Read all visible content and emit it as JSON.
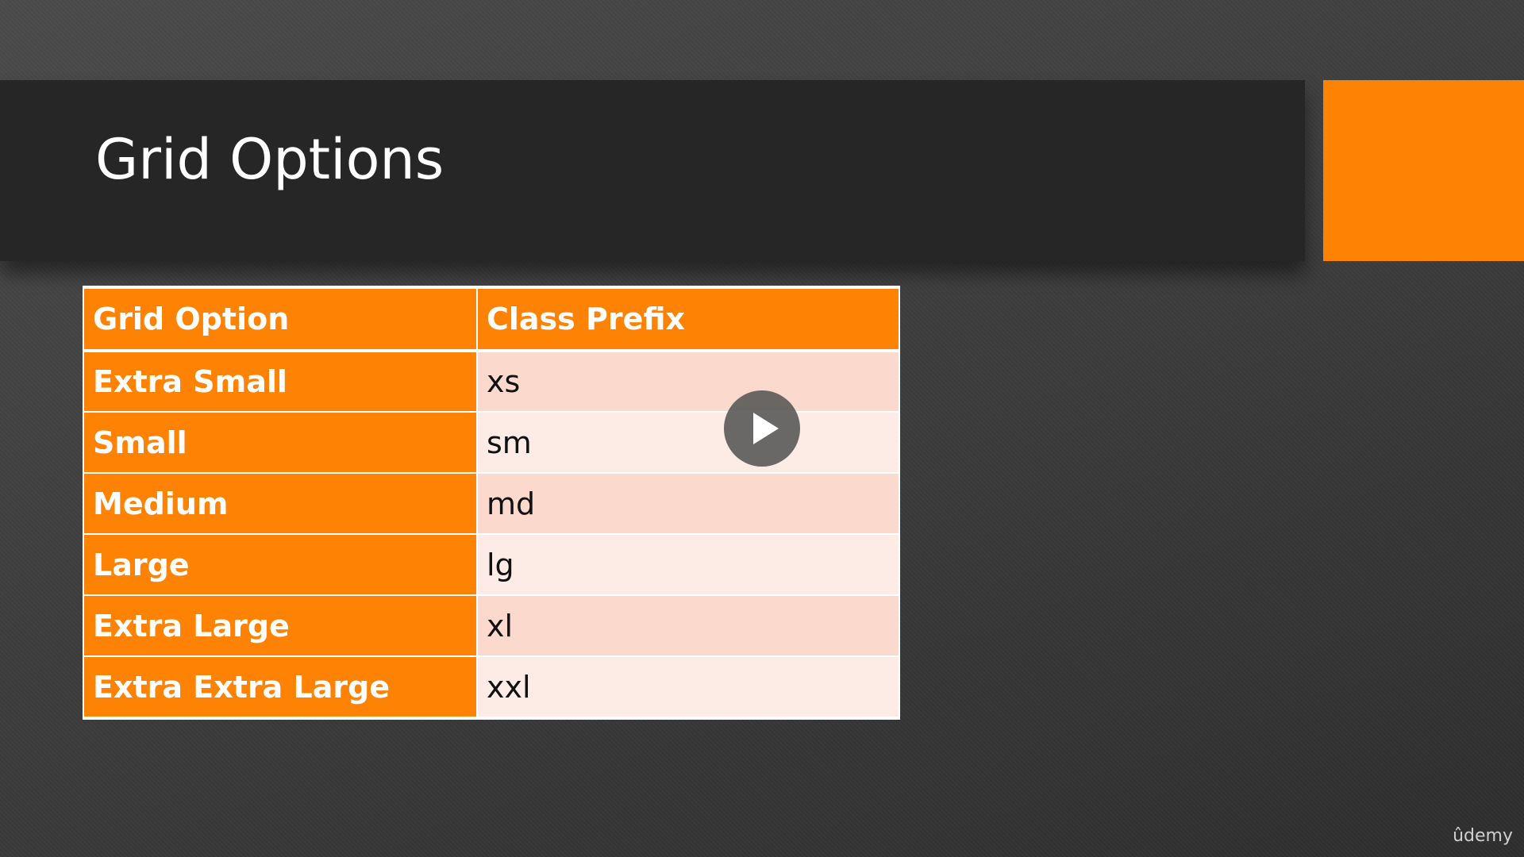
{
  "slide": {
    "title": "Grid Options"
  },
  "table": {
    "headers": [
      "Grid Option",
      "Class Prefix"
    ],
    "rows": [
      {
        "option": "Extra Small",
        "prefix": "xs"
      },
      {
        "option": "Small",
        "prefix": "sm"
      },
      {
        "option": "Medium",
        "prefix": "md"
      },
      {
        "option": "Large",
        "prefix": "lg"
      },
      {
        "option": "Extra Large",
        "prefix": "xl"
      },
      {
        "option": "Extra Extra Large",
        "prefix": "xxl"
      }
    ]
  },
  "player": {
    "play_icon": "play-icon"
  },
  "brand": {
    "logo_text": "ûdemy"
  },
  "colors": {
    "accent": "#fe8203",
    "title_band": "#262626",
    "row_odd": "#fcd9cd",
    "row_even": "#fdece6"
  }
}
